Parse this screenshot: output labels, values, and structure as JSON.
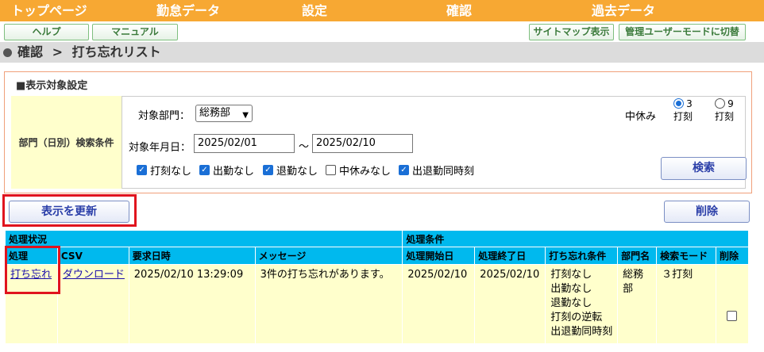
{
  "topnav": [
    "トップページ",
    "勤怠データ",
    "設定",
    "確認",
    "過去データ"
  ],
  "subnav": {
    "help": "ヘルプ",
    "manual": "マニュアル",
    "sitemap": "サイトマップ表示",
    "admin_mode": "管理ユーザーモードに切替"
  },
  "breadcrumb": {
    "parent": "確認",
    "sep": ">",
    "current": "打ち忘れリスト"
  },
  "settings": {
    "title": "■表示対象設定",
    "condition_label": "部門（日別）検索条件",
    "dept_label": "対象部門：",
    "dept_value": "総務部",
    "date_label": "対象年月日：",
    "date_from": "2025/02/01",
    "tilde": "～",
    "date_to": "2025/02/10",
    "break_label": "中休み",
    "radio_3": "3",
    "radio_9": "9",
    "radio_3_sub": "打刻",
    "radio_9_sub": "打刻",
    "radio_selected": "3",
    "checks": [
      {
        "label": "打刻なし",
        "checked": true
      },
      {
        "label": "出勤なし",
        "checked": true
      },
      {
        "label": "退勤なし",
        "checked": true
      },
      {
        "label": "中休みなし",
        "checked": false
      },
      {
        "label": "出退勤同時刻",
        "checked": true
      }
    ],
    "search_button": "検索"
  },
  "actions": {
    "refresh": "表示を更新",
    "delete": "削除"
  },
  "table": {
    "section_status": "処理状況",
    "section_condition": "処理条件",
    "columns": [
      "処理",
      "CSV",
      "要求日時",
      "メッセージ",
      "処理開始日",
      "処理終了日",
      "打ち忘れ条件",
      "部門名",
      "検索モード",
      "削除"
    ],
    "rows": [
      {
        "process": "打ち忘れ",
        "csv": "ダウンロード",
        "requested_at": "2025/02/10 13:29:09",
        "message": "3件の打ち忘れがあります。",
        "start_date": "2025/02/10",
        "end_date": "2025/02/10",
        "conditions": [
          "打刻なし",
          "出勤なし",
          "退勤なし",
          "打刻の逆転",
          "出退勤同時刻"
        ],
        "dept": "総務部",
        "mode": "３打刻",
        "delete_checked": false
      }
    ]
  },
  "colors": {
    "topnav": "#f7a833",
    "table_header": "#00b9ee",
    "cell_bg": "#ffffcc",
    "highlight": "#e0141e"
  }
}
